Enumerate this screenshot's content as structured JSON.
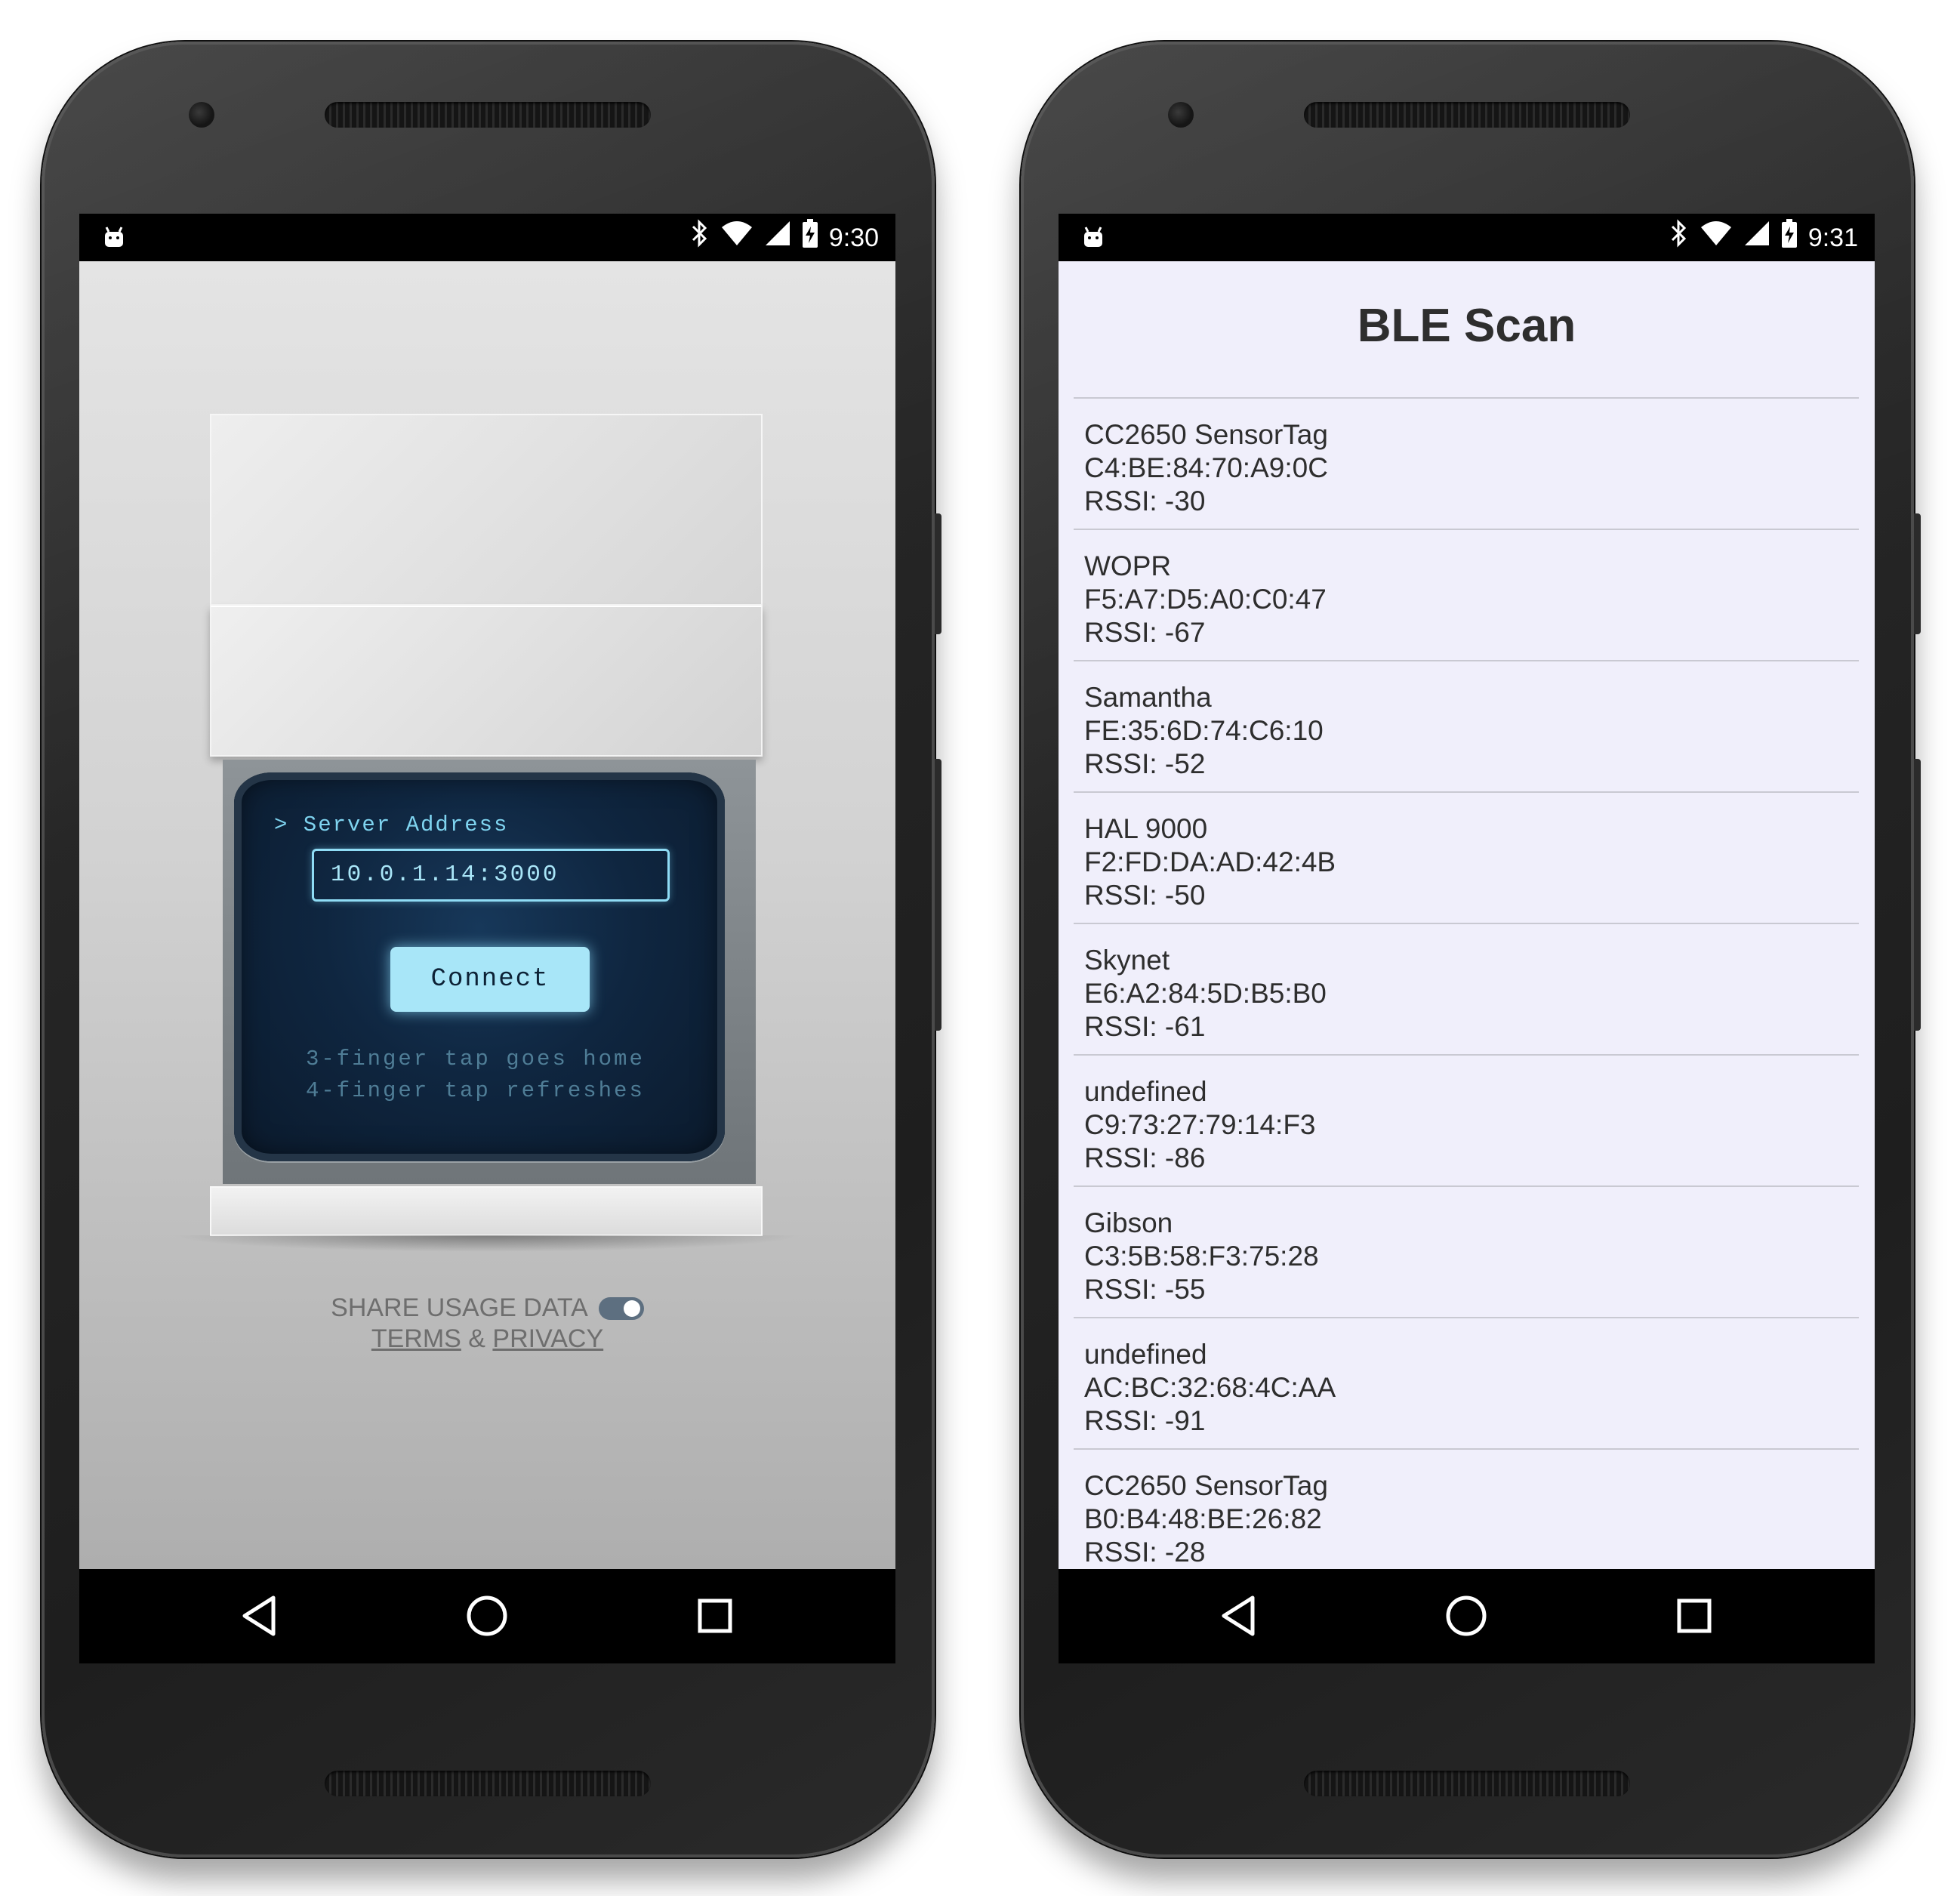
{
  "left_phone": {
    "status_time": "9:30",
    "server_label": "> Server Address",
    "server_value": "10.0.1.14:3000",
    "connect_label": "Connect",
    "hint_line1": "3-finger tap goes home",
    "hint_line2": "4-finger tap refreshes",
    "share_label": "SHARE USAGE DATA",
    "share_enabled": true,
    "terms_label": "TERMS",
    "ampersand": "&",
    "privacy_label": "PRIVACY"
  },
  "right_phone": {
    "status_time": "9:31",
    "title": "BLE Scan",
    "devices": [
      {
        "name": "CC2650 SensorTag",
        "address": "C4:BE:84:70:A9:0C",
        "rssi": "RSSI: -30"
      },
      {
        "name": "WOPR",
        "address": "F5:A7:D5:A0:C0:47",
        "rssi": "RSSI: -67"
      },
      {
        "name": "Samantha",
        "address": "FE:35:6D:74:C6:10",
        "rssi": "RSSI: -52"
      },
      {
        "name": "HAL 9000",
        "address": "F2:FD:DA:AD:42:4B",
        "rssi": "RSSI: -50"
      },
      {
        "name": "Skynet",
        "address": "E6:A2:84:5D:B5:B0",
        "rssi": "RSSI: -61"
      },
      {
        "name": "undefined",
        "address": "C9:73:27:79:14:F3",
        "rssi": "RSSI: -86"
      },
      {
        "name": "Gibson",
        "address": "C3:5B:58:F3:75:28",
        "rssi": "RSSI: -55"
      },
      {
        "name": "undefined",
        "address": "AC:BC:32:68:4C:AA",
        "rssi": "RSSI: -91"
      },
      {
        "name": "CC2650 SensorTag",
        "address": "B0:B4:48:BE:26:82",
        "rssi": "RSSI: -28"
      }
    ]
  },
  "icons": {
    "status": [
      "android-debug-icon",
      "bluetooth-icon",
      "wifi-icon",
      "cell-signal-icon",
      "battery-charging-icon"
    ],
    "nav": [
      "back-icon",
      "home-icon",
      "recents-icon"
    ]
  }
}
